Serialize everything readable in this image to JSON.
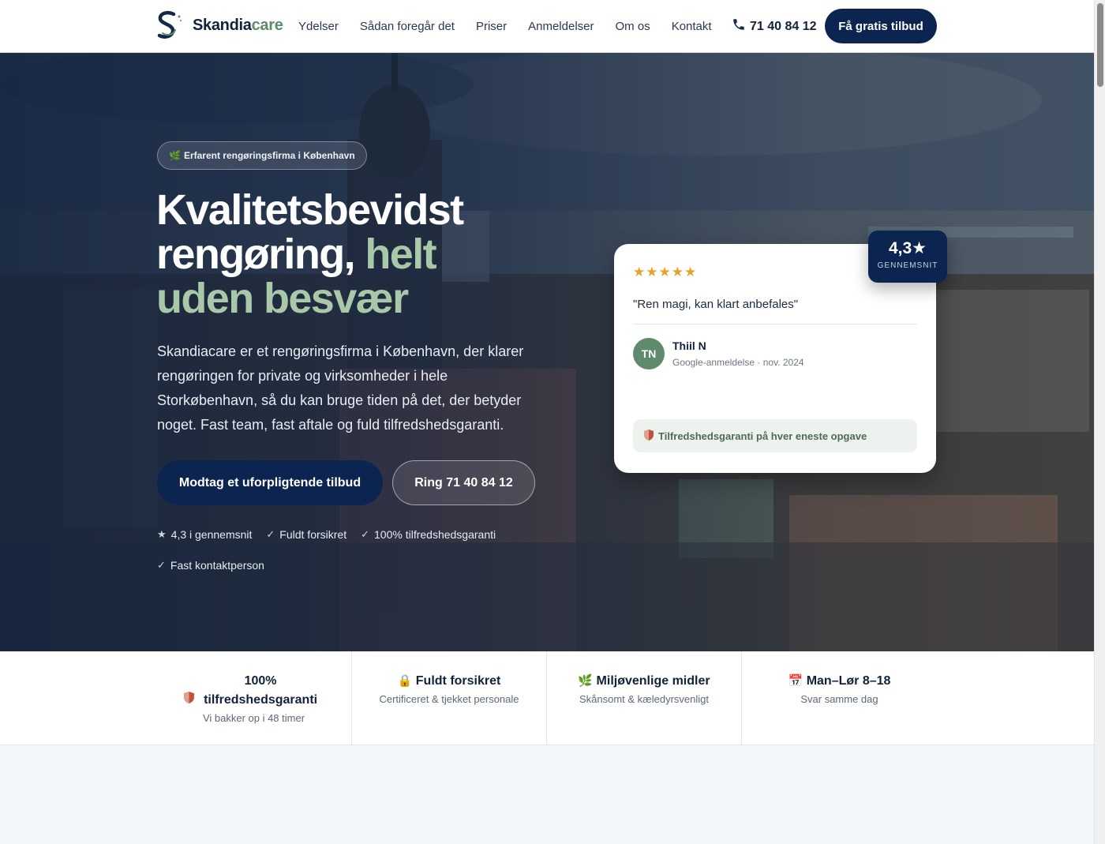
{
  "header": {
    "brand_main": "Skandia",
    "brand_accent": "care",
    "nav": [
      "Ydelser",
      "Sådan foregår det",
      "Priser",
      "Anmeldelser",
      "Om os",
      "Kontakt"
    ],
    "phone": "71 40 84 12",
    "cta": "Få gratis tilbud"
  },
  "hero": {
    "badge": "Erfarent rengøringsfirma i København",
    "title_line1": "Kvalitetsbevidst",
    "title_line2_white": "rengøring,",
    "title_line2_green": "helt",
    "title_line3_green": "uden besvær",
    "description": "Skandiacare er et rengøringsfirma i København, der klarer rengøringen for private og virksomheder i hele Storkøbenhavn, så du kan bruge tiden på det, der betyder noget. Fast team, fast aftale og fuld tilfredshedsgaranti.",
    "primary_button": "Modtag et uforpligtende tilbud",
    "secondary_button": "Ring 71 40 84 12",
    "features": [
      {
        "icon": "star-icon",
        "text": "4,3 i gennemsnit"
      },
      {
        "icon": "check-icon",
        "text": "Fuldt forsikret"
      },
      {
        "icon": "check-icon",
        "text": "100% tilfredshedsgaranti"
      },
      {
        "icon": "check-icon",
        "text": "Fast kontaktperson"
      }
    ]
  },
  "review": {
    "stars": "★★★★★",
    "quote": "\"Ren magi, kan klart anbefales\"",
    "initials": "TN",
    "name": "Thiil N",
    "meta": "Google-anmeldelse · nov. 2024",
    "guarantee": "Tilfredshedsgaranti på hver eneste opgave",
    "rating_value": "4,3★",
    "rating_label": "GENNEMSNIT"
  },
  "trust": [
    {
      "icon": "shield-icon",
      "title": "100% tilfredshedsgaranti",
      "sub": "Vi bakker op i 48 timer"
    },
    {
      "icon": "lock-icon",
      "title": "Fuldt forsikret",
      "sub": "Certificeret & tjekket personale"
    },
    {
      "icon": "leaf-icon",
      "title": "Miljøvenlige midler",
      "sub": "Skånsomt & kæledyrsvenligt"
    },
    {
      "icon": "calendar-icon",
      "title": "Man–Lør 8–18",
      "sub": "Svar samme dag"
    }
  ],
  "colors": {
    "navy": "#0c2550",
    "green_accent": "#a9c7a9",
    "star": "#e2a52c"
  }
}
